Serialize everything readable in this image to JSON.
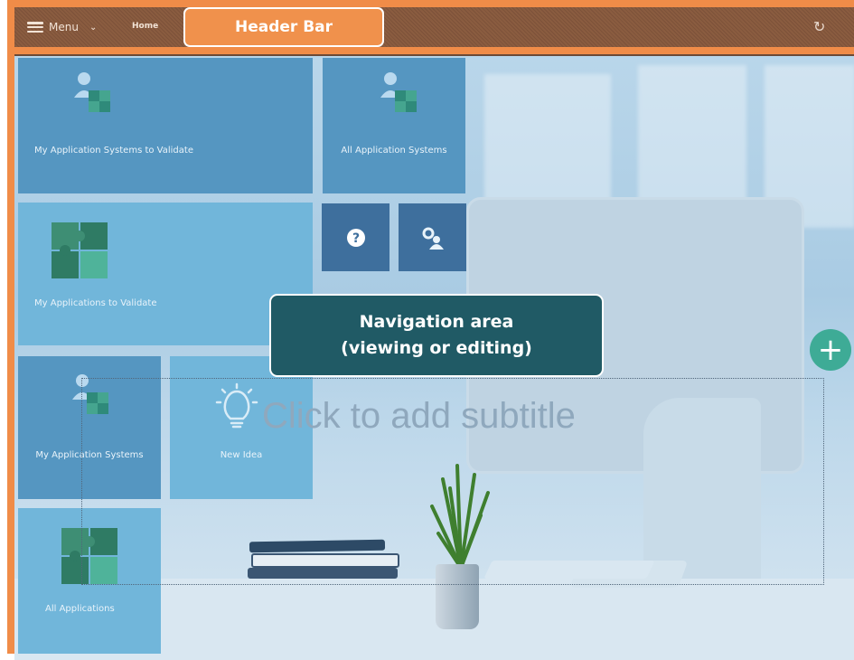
{
  "header": {
    "menu_label": "Menu",
    "home_label": "Home",
    "callout": "Header Bar",
    "refresh_icon": "refresh-icon"
  },
  "tiles": [
    {
      "label": "My Application Systems to Validate",
      "icon": "person-puzzle-icon"
    },
    {
      "label": "All Application Systems",
      "icon": "person-puzzle-icon"
    },
    {
      "label": "My Applications to Validate",
      "icon": "puzzle-icon"
    },
    {
      "label": "",
      "icon": "help-icon"
    },
    {
      "label": "",
      "icon": "people-settings-icon"
    },
    {
      "label": "My Application Systems",
      "icon": "person-puzzle-icon"
    },
    {
      "label": "New Idea",
      "icon": "lightbulb-icon"
    },
    {
      "label": "All Applications",
      "icon": "puzzle-icon"
    }
  ],
  "navigation_callout": {
    "line1": "Navigation area",
    "line2": "(viewing or editing)"
  },
  "subtitle_placeholder": "Click to add subtitle",
  "add_button": "+",
  "colors": {
    "header_orange": "#f08c48",
    "header_brown": "#8a5c40",
    "callout_teal": "#205a65",
    "add_green": "#3eab96"
  }
}
